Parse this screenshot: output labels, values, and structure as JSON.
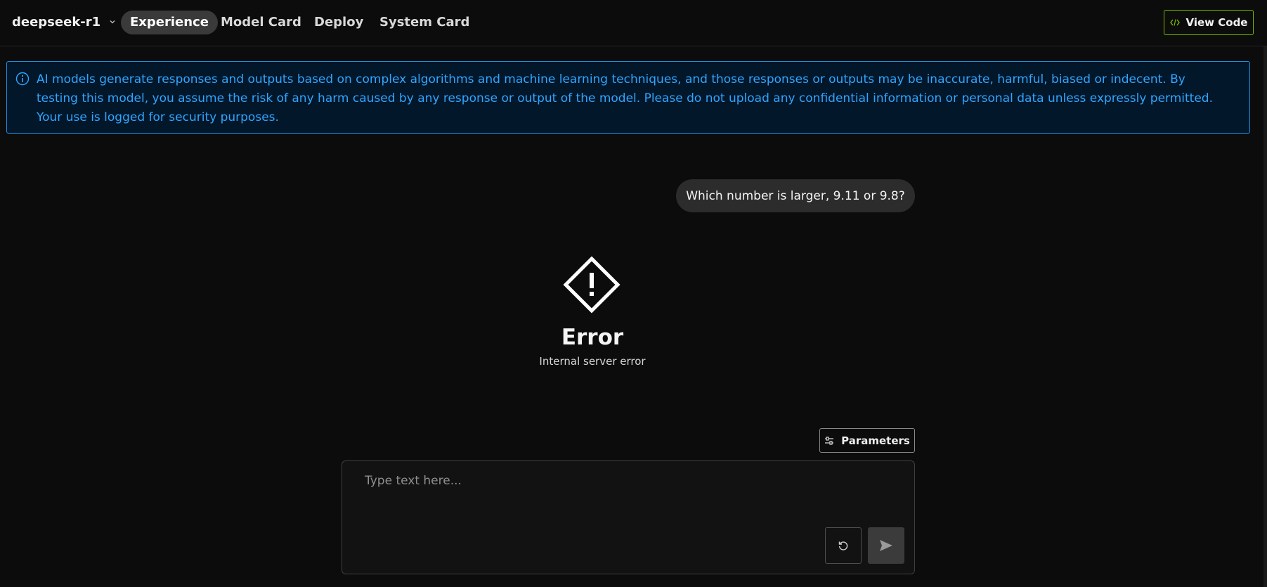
{
  "header": {
    "model_name": "deepseek-r1",
    "tabs": [
      {
        "label": "Experience",
        "active": true
      },
      {
        "label": "Model Card",
        "active": false
      },
      {
        "label": "Deploy",
        "active": false
      },
      {
        "label": "System Card",
        "active": false
      }
    ],
    "view_code_label": "View Code"
  },
  "notice": {
    "text": "AI models generate responses and outputs based on complex algorithms and machine learning techniques, and those responses or outputs may be inaccurate, harmful, biased or indecent. By testing this model, you assume the risk of any harm caused by any response or output of the model. Please do not upload any confidential information or personal data unless expressly permitted. Your use is logged for security purposes."
  },
  "chat": {
    "user_message": "Which number is larger, 9.11 or 9.8?",
    "error_title": "Error",
    "error_message": "Internal server error"
  },
  "composer": {
    "parameters_label": "Parameters",
    "placeholder": "Type text here...",
    "value": ""
  },
  "icons": {
    "model_dropdown": "chevron-down-icon",
    "view_code": "code-icon",
    "notice": "info-icon",
    "error": "warning-diamond-icon",
    "parameters": "sliders-icon",
    "reset": "reset-icon",
    "send": "send-icon"
  },
  "colors": {
    "background": "#0c0c0c",
    "accent_green": "#76b900",
    "notice_blue": "#2fa6ff",
    "notice_background": "#03172b"
  }
}
